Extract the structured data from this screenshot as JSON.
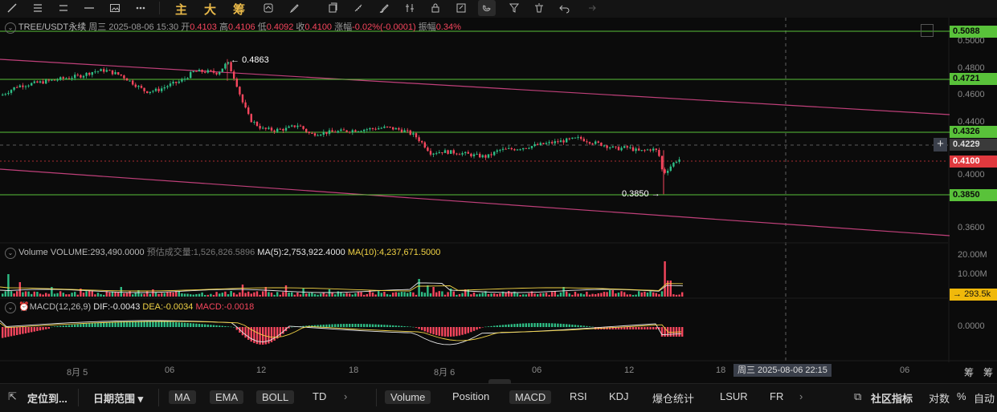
{
  "toolbar": {
    "tools": [
      "line-tool",
      "menu-tool",
      "hline-tool",
      "hline2-tool",
      "image-tool",
      "dots-tool"
    ],
    "chinese": [
      "主",
      "大",
      "筹"
    ],
    "tools2": [
      "sync-tool",
      "pen-tool",
      "copy-tool",
      "ruler-tool",
      "brush-tool",
      "bars-tool",
      "lock-tool",
      "note-tool",
      "magnet-tool",
      "filter-tool",
      "trash-tool",
      "undo-tool",
      "redo-tool"
    ]
  },
  "header": {
    "symbol": "TREE/USDT永续",
    "datetime": "周三 2025-08-06 15:30",
    "open_label": "开",
    "open": "0.4103",
    "high_label": "高",
    "high": "0.4106",
    "low_label": "低",
    "low": "0.4092",
    "close_label": "收",
    "close": "0.4100",
    "change_label": "涨幅",
    "change": "-0.02%(-0.0001)",
    "amplitude_label": "振幅",
    "amplitude": "0.34%"
  },
  "price_tags": {
    "p5088": "0.5088",
    "p4721": "0.4721",
    "p4326": "0.4326",
    "p4229": "0.4229",
    "p4100": "0.4100",
    "p3850": "0.3850"
  },
  "price_axis": [
    "0.5000",
    "0.4800",
    "0.4600",
    "0.4400",
    "0.4000",
    "0.3600"
  ],
  "annotations": {
    "high": "0.4863",
    "low": "0.3850"
  },
  "volume": {
    "title": "Volume",
    "value": "VOLUME:293,490.0000",
    "est": "预估成交量:1,526,826.5896",
    "ma5": "MA(5):2,753,922.4000",
    "ma10": "MA(10):4,237,671.5000",
    "axis": [
      "20.00M",
      "10.00M"
    ],
    "current": "293.5k"
  },
  "macd": {
    "title": "MACD(12,26,9)",
    "dif": "DIF:-0.0043",
    "dea": "DEA:-0.0034",
    "macd": "MACD:-0.0018",
    "axis": "0.0000"
  },
  "time_axis": [
    "8月 5",
    "06",
    "12",
    "18",
    "8月 6",
    "06",
    "12",
    "18",
    "06"
  ],
  "crosshair_time": "周三 2025-08-06 22:15",
  "side_chars": [
    "筹",
    "筹"
  ],
  "bottom": {
    "locate": "定位到...",
    "range": "日期范围",
    "indicators_main": [
      "MA",
      "EMA",
      "BOLL",
      "TD"
    ],
    "indicators_sub": [
      "Volume",
      "Position",
      "MACD",
      "RSI",
      "KDJ",
      "爆仓统计",
      "LSUR",
      "FR"
    ],
    "community": "社区指标",
    "log": "对数",
    "percent": "%",
    "auto": "自动"
  },
  "colors": {
    "up": "#2ebd85",
    "down": "#f6465d",
    "level": "#59c23a",
    "trend": "#c0407a",
    "yellow": "#f0d245"
  }
}
